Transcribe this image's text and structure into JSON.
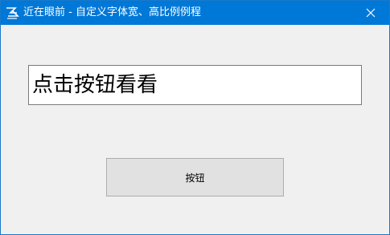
{
  "window": {
    "title": "近在眼前 - 自定义字体宽、高比例例程",
    "app_icon": "app-logo-icon",
    "close_icon": "close-icon",
    "titlebar_color": "#0078d7",
    "client_background": "#f0f0f0"
  },
  "content": {
    "text_field_value": "点击按钮看看",
    "button_label": "按钮"
  }
}
